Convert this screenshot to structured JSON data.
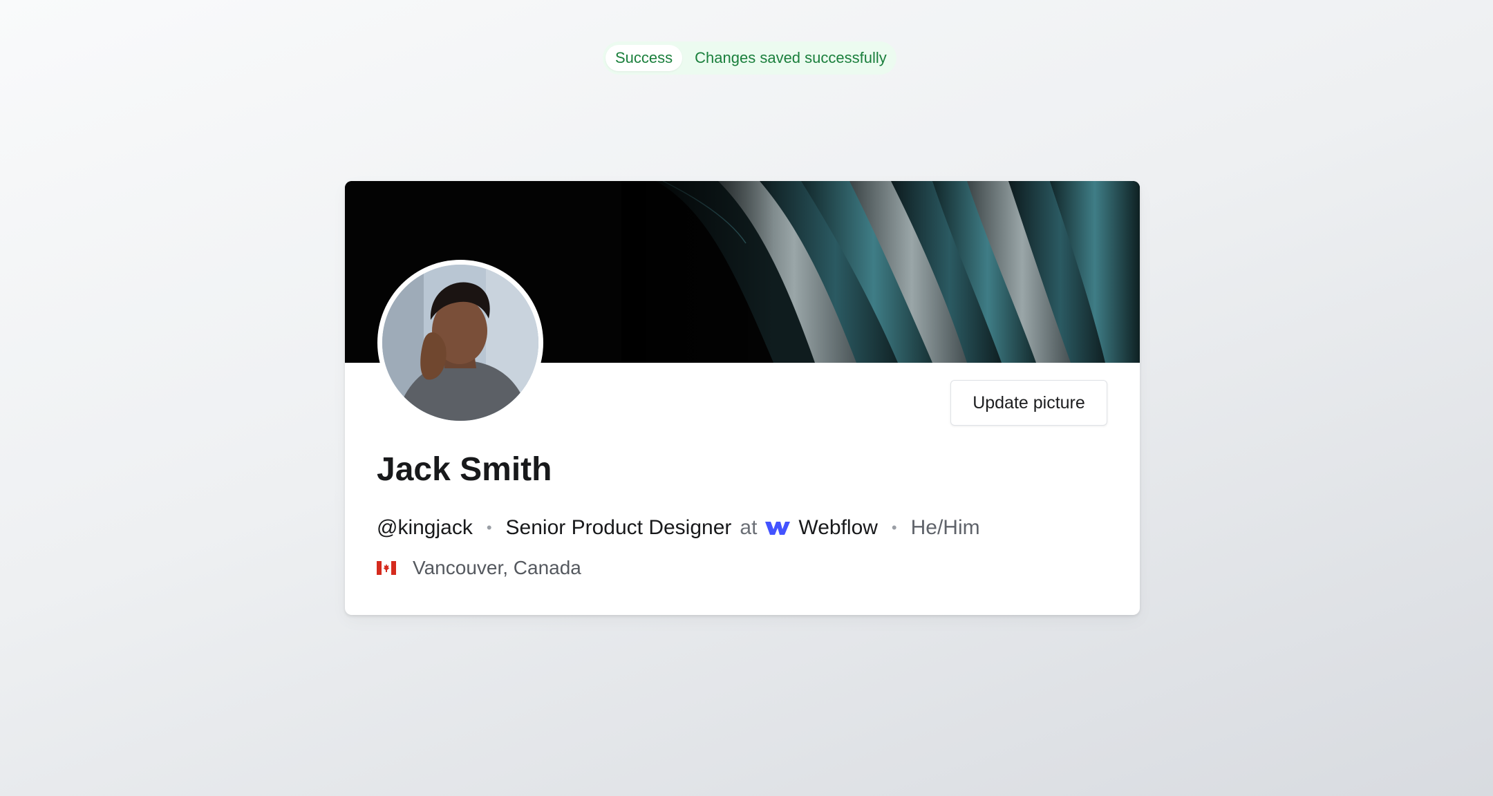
{
  "toast": {
    "badge": "Success",
    "message": "Changes saved successfully",
    "color": "#1a7f3c"
  },
  "profile": {
    "name": "Jack Smith",
    "handle": "@kingjack",
    "role": "Senior Product Designer",
    "at_word": "at",
    "company": "Webflow",
    "company_icon": "webflow-logo-icon",
    "company_color": "#4353ff",
    "pronouns": "He/Him",
    "location": "Vancouver, Canada",
    "location_icon": "canada-flag-icon",
    "separator": "•"
  },
  "actions": {
    "update_picture_label": "Update picture"
  }
}
